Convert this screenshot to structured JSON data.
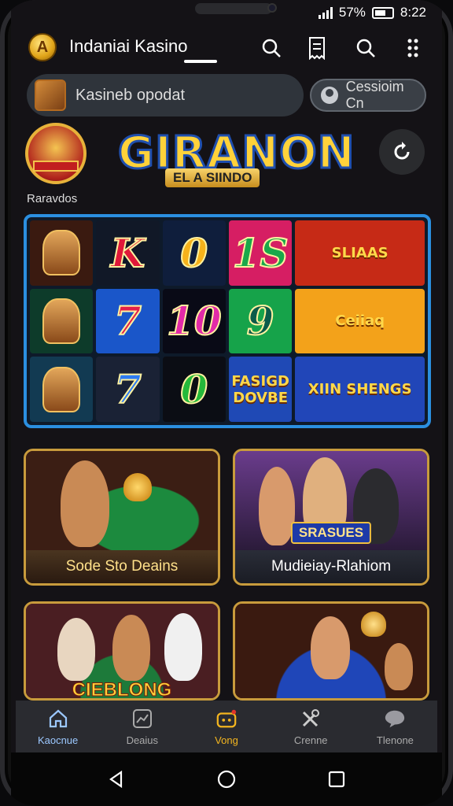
{
  "status": {
    "battery": "57%",
    "time": "8:22"
  },
  "header": {
    "title": "Indaniai Kasino",
    "icons": [
      "search-icon",
      "receipt-icon",
      "search-icon",
      "more-icon"
    ]
  },
  "search": {
    "placeholder": "Kasineb opodat"
  },
  "login": {
    "label": "Cessioim Cn"
  },
  "promo": {
    "badge_label": "Raravdos",
    "banner_title": "GIRANON",
    "banner_subtitle": "EL A SIINDO"
  },
  "slots": [
    {
      "text": "",
      "kind": "art",
      "bg": "#3a1a10"
    },
    {
      "text": "K",
      "kind": "sym",
      "bg": "#111827",
      "color": "#e0193a"
    },
    {
      "text": "0",
      "kind": "sym",
      "bg": "#0f1e3c",
      "color": "#f6b21b"
    },
    {
      "text": "1S",
      "kind": "sym",
      "bg": "#d61e63",
      "color": "#1aa84a"
    },
    {
      "text": "SLIAAS",
      "kind": "small",
      "bg": "#c62a16"
    },
    {
      "text": "",
      "kind": "art",
      "bg": "#0d3b2a"
    },
    {
      "text": "7",
      "kind": "sym",
      "bg": "#1a56c9",
      "color": "#e21f4a"
    },
    {
      "text": "10",
      "kind": "sym",
      "bg": "#090a16",
      "color": "#e22aa8"
    },
    {
      "text": "9",
      "kind": "sym",
      "bg": "#16a34a",
      "color": "#0b5b4a"
    },
    {
      "text": "Ceiiaq",
      "kind": "small",
      "bg": "#f3a21a"
    },
    {
      "text": "",
      "kind": "art",
      "bg": "#123a52"
    },
    {
      "text": "7",
      "kind": "sym",
      "bg": "#1a2235",
      "color": "#2d7bf3"
    },
    {
      "text": "0",
      "kind": "sym",
      "bg": "#0b0d14",
      "color": "#25b93a"
    },
    {
      "text": "FASIGD DOVBE",
      "kind": "small",
      "bg": "#1f49b5"
    },
    {
      "text": "XIIN SHENGS",
      "kind": "small",
      "bg": "#2146b8"
    }
  ],
  "cards": [
    {
      "label": "Sode Sto Deains"
    },
    {
      "label": "Mudieiay-Rlahiom",
      "overlay": "SRASUES"
    },
    {
      "label": "",
      "overlay": "CIEBLONG"
    },
    {
      "label": ""
    }
  ],
  "bottom_nav": [
    {
      "label": "Kaocnue",
      "icon": "home-icon"
    },
    {
      "label": "Deaius",
      "icon": "chart-icon"
    },
    {
      "label": "Vong",
      "icon": "wallet-icon"
    },
    {
      "label": "Crenne",
      "icon": "tools-icon"
    },
    {
      "label": "Tlenone",
      "icon": "chat-icon"
    }
  ]
}
